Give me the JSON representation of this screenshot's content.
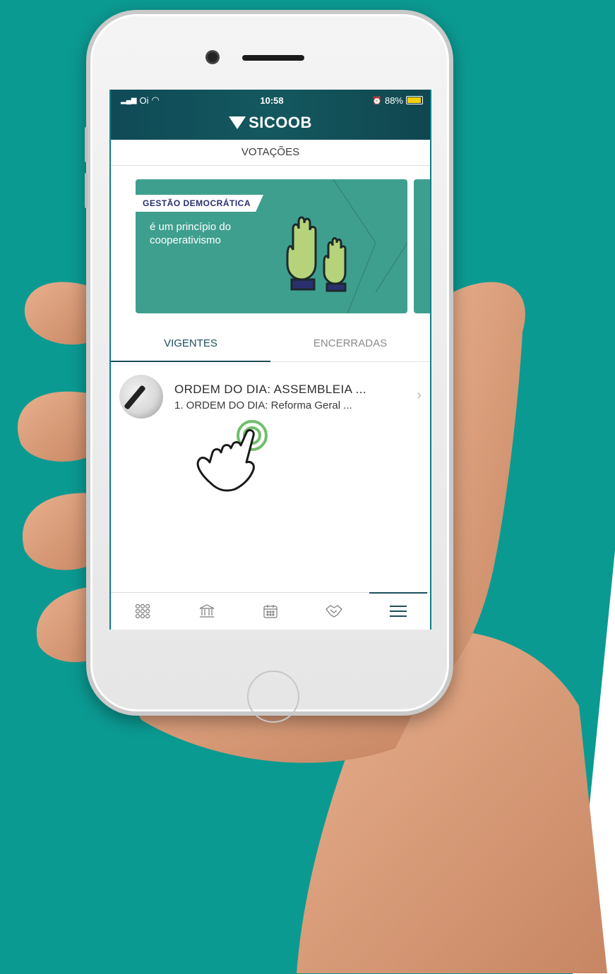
{
  "status_bar": {
    "carrier": "Oi",
    "time": "10:58",
    "battery": "88%"
  },
  "app": {
    "brand": "SICOOB",
    "page_title": "VOTAÇÕES"
  },
  "banner": {
    "tag": "GESTÃO DEMOCRÁTICA",
    "text": "é um princípio do cooperativismo"
  },
  "tabs": [
    {
      "label": "VIGENTES",
      "active": true
    },
    {
      "label": "ENCERRADAS",
      "active": false
    }
  ],
  "list": [
    {
      "title": "ORDEM DO DIA: ASSEMBLEIA ...",
      "subtitle": "1. ORDEM DO DIA: Reforma Geral ..."
    }
  ],
  "bottom_nav": [
    {
      "icon": "apps-grid-icon",
      "active": false
    },
    {
      "icon": "bank-icon",
      "active": false
    },
    {
      "icon": "calendar-icon",
      "active": false
    },
    {
      "icon": "handshake-icon",
      "active": false
    },
    {
      "icon": "menu-icon",
      "active": true
    }
  ],
  "colors": {
    "background": "#0b9a92",
    "header": "#0f4a56",
    "banner": "#3f9f8f",
    "accent": "#1d4f5a"
  }
}
